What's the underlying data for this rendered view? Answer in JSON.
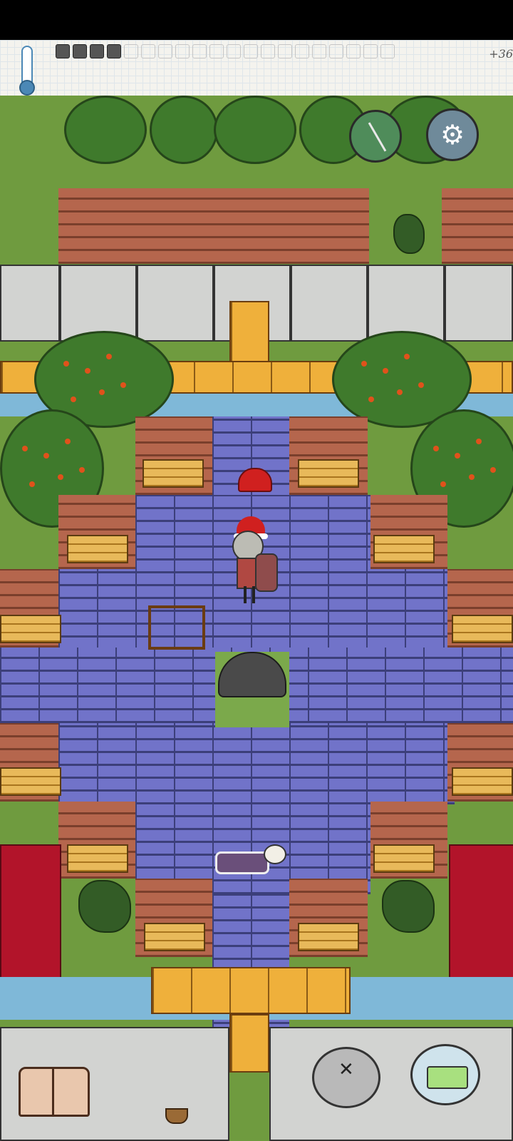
{
  "hud": {
    "temperature_label": "+36",
    "food_slots": {
      "filled": 4,
      "total": 20
    }
  },
  "buttons": {
    "compass_icon": "compass-icon",
    "settings_icon": "gear-icon",
    "book_icon": "open-book-icon",
    "puppet_icon": "puppet-icon",
    "keyboard_icon": "keyboard-icon"
  },
  "colors": {
    "grass": "#7ba94b",
    "cobblestone": "#7173c9",
    "brick": "#b5664d",
    "water": "#7fb8d8",
    "wood": "#efb03b",
    "tent": "#b2142a"
  }
}
